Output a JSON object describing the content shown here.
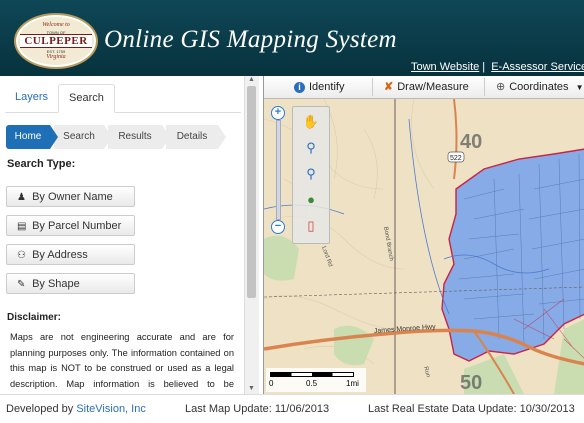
{
  "header": {
    "logo": {
      "welcome": "Welcome to",
      "town_of": "TOWN OF",
      "name": "CULPEPER",
      "est": "EST. 1759",
      "state": "Virginia"
    },
    "title": "Online GIS Mapping System",
    "links": [
      "Town Website",
      "E-Assessor Services"
    ],
    "separator": "|"
  },
  "left_panel": {
    "tabs": [
      {
        "label": "Layers",
        "active": false
      },
      {
        "label": "Search",
        "active": true
      }
    ],
    "breadcrumbs": [
      {
        "label": "Home",
        "active": true
      },
      {
        "label": "Search"
      },
      {
        "label": "Results"
      },
      {
        "label": "Details"
      }
    ],
    "search_type_label": "Search Type:",
    "search_buttons": [
      {
        "label": "By Owner Name",
        "icon": "user-icon"
      },
      {
        "label": "By Parcel Number",
        "icon": "book-icon"
      },
      {
        "label": "By Address",
        "icon": "binoculars-icon"
      },
      {
        "label": "By Shape",
        "icon": "pencil-icon"
      }
    ],
    "disclaimer_label": "Disclaimer:",
    "disclaimer_text": "Maps are not engineering accurate and are for planning purposes only. The information contained on this map is NOT to be construed or used as a legal description. Map information is believed to be accurate but accuracy is"
  },
  "map": {
    "toolbar": [
      {
        "label": "Identify",
        "icon": "info-icon"
      },
      {
        "label": "Draw/Measure",
        "icon": "draw-icon"
      },
      {
        "label": "Coordinates",
        "icon": "crosshair-icon"
      }
    ],
    "tools": [
      "pan-hand-icon",
      "zoom-in-icon",
      "zoom-out-icon",
      "globe-icon",
      "eraser-icon"
    ],
    "grid_labels": [
      "40",
      "50"
    ],
    "route_label": "522",
    "road_labels": [
      "James Monroe Hwy",
      "Bond Branch",
      "Lord Rd",
      "Run"
    ],
    "scale": {
      "labels": [
        "0",
        "0.5",
        "1mi"
      ]
    }
  },
  "footer": {
    "developed_by": "Developed by",
    "developer": "SiteVision, Inc",
    "last_map_update": "Last Map Update: 11/06/2013",
    "last_re_update": "Last Real Estate Data Update: 10/30/2013"
  },
  "colors": {
    "header_bg": "#0b3c4a",
    "accent": "#1f6fb6",
    "town_fill": "#7aa6e8",
    "road": "#d9844f"
  }
}
